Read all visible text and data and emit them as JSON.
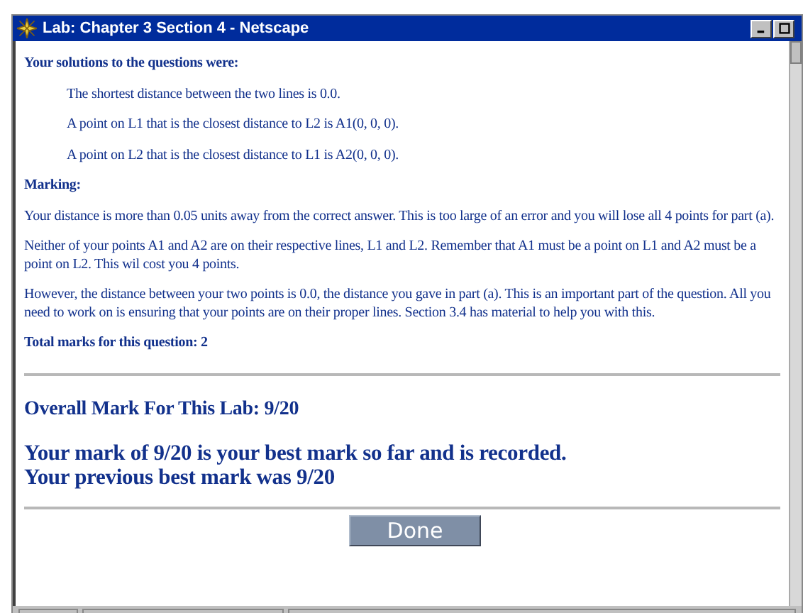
{
  "window": {
    "title": "Lab: Chapter 3 Section 4 - Netscape"
  },
  "solutions_heading": "Your solutions to the questions were:",
  "solutions": [
    "The shortest distance between the two lines is 0.0.",
    "A point on L1 that is the closest distance to L2 is A1(0, 0, 0).",
    "A point on L2 that is the closest distance to L1 is A2(0, 0, 0)."
  ],
  "marking_heading": "Marking:",
  "marking": [
    "Your distance is more than 0.05 units away from the correct answer. This is too large of an error and you will lose all 4 points for part (a).",
    "Neither of your points A1 and A2 are on their respective lines, L1 and L2. Remember that A1 must be a point on L1 and A2 must be a point on L2. This wil cost you 4 points.",
    "However, the distance between your two points is 0.0, the distance you gave in part (a). This is an important part of the question. All you need to work on is ensuring that your points are on their proper lines. Section 3.4 has material to help you with this."
  ],
  "total": "Total marks for this question: 2",
  "overall": "Overall Mark For This Lab: 9/20",
  "best_lines": [
    "Your mark of 9/20 is your best mark so far and is recorded.",
    "Your previous best mark was 9/20"
  ],
  "done_button": "Done"
}
